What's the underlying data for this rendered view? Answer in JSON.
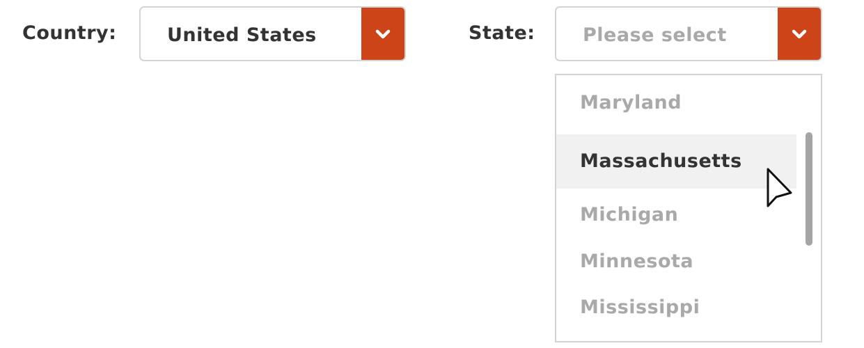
{
  "country": {
    "label": "Country:",
    "value": "United States"
  },
  "state": {
    "label": "State:",
    "placeholder": "Please select"
  },
  "dropdown": {
    "options": [
      "Maryland",
      "Massachusetts",
      "Michigan",
      "Minnesota",
      "Mississippi"
    ],
    "highlighted": "Massachusetts"
  },
  "colors": {
    "accent": "#cd4418",
    "option_text": "#a9a9a9",
    "selected_text": "#333333",
    "highlight_bg": "#f1f1f1"
  },
  "icons": {
    "select_arrow": "chevron-down-icon",
    "cursor": "mouse-pointer-icon"
  }
}
